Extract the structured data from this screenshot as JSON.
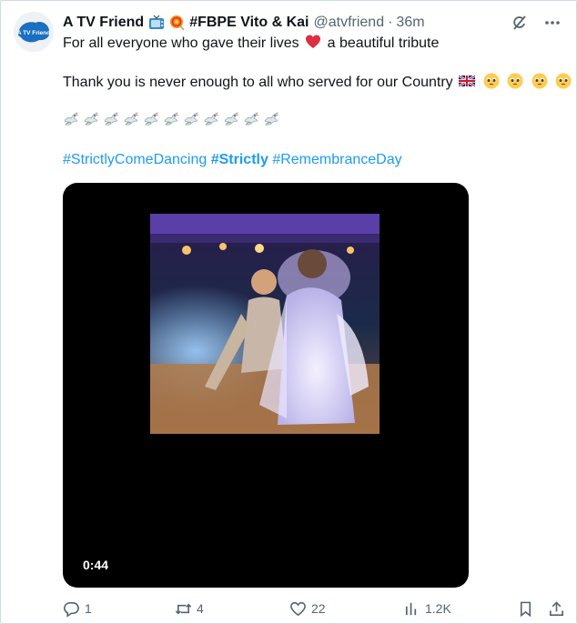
{
  "tweet": {
    "display_name": "A TV Friend",
    "display_name_suffix": "#FBPE Vito & Kai",
    "handle": "@atvfriend",
    "separator": "·",
    "time": "36m",
    "avatar_text": "A TV Friend",
    "line1_before": "For all everyone who gave their lives",
    "line1_after": "a beautiful tribute",
    "line2": "Thank you is never enough to all who served for our Country",
    "hashtags": [
      "#StrictlyComeDancing",
      "#Strictly",
      "#RemembranceDay"
    ],
    "dove_count": 11,
    "icons": {
      "name_emoji_1": "television-icon",
      "name_emoji_2": "lollipop-icon",
      "heart_emoji": "red-heart-icon",
      "flag_emoji": "uk-flag-icon",
      "pleading_emoji": "pleading-face-icon",
      "dove_emoji": "dove-icon"
    }
  },
  "video": {
    "duration": "0:44"
  },
  "actions": {
    "replies": "1",
    "reposts": "4",
    "likes": "22",
    "views": "1.2K"
  },
  "colors": {
    "link": "#1d9bf0",
    "secondary": "#536471",
    "text": "#0f1419",
    "avatar_brand": "#1a6fc0"
  }
}
